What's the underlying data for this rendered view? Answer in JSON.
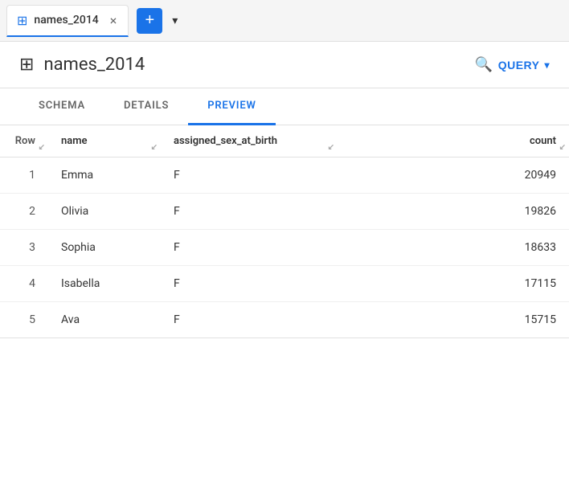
{
  "tabBar": {
    "tabLabel": "names_2014",
    "tabIcon": "⊞",
    "closeLabel": "×",
    "addLabel": "+",
    "dropdownArrow": "▾"
  },
  "header": {
    "tableIcon": "⊞",
    "title": "names_2014",
    "queryButton": "QUERY",
    "queryDropdown": "▾"
  },
  "viewTabs": [
    {
      "id": "schema",
      "label": "SCHEMA"
    },
    {
      "id": "details",
      "label": "DETAILS"
    },
    {
      "id": "preview",
      "label": "PREVIEW"
    }
  ],
  "activeTab": "preview",
  "table": {
    "columns": [
      {
        "id": "row",
        "label": "Row"
      },
      {
        "id": "name",
        "label": "name"
      },
      {
        "id": "sex",
        "label": "assigned_sex_at_birth"
      },
      {
        "id": "count",
        "label": "count"
      }
    ],
    "rows": [
      {
        "row": "1",
        "name": "Emma",
        "sex": "F",
        "count": "20949"
      },
      {
        "row": "2",
        "name": "Olivia",
        "sex": "F",
        "count": "19826"
      },
      {
        "row": "3",
        "name": "Sophia",
        "sex": "F",
        "count": "18633"
      },
      {
        "row": "4",
        "name": "Isabella",
        "sex": "F",
        "count": "17115"
      },
      {
        "row": "5",
        "name": "Ava",
        "sex": "F",
        "count": "15715"
      }
    ]
  }
}
